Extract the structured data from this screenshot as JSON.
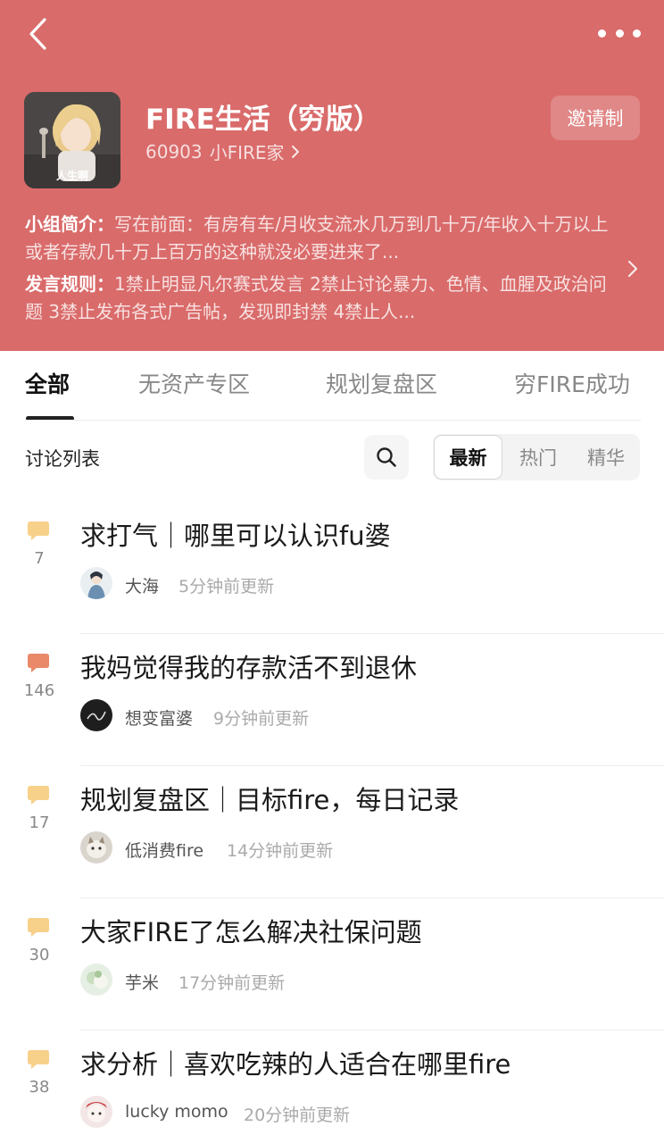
{
  "header": {
    "back_icon": "chevron-left-icon",
    "more_icon": "more-dots-icon",
    "group_title": "FIRE生活（穷版）",
    "member_count": "60903",
    "member_label": "小FIRE家",
    "invite_label": "邀请制",
    "avatar_caption": "人生啊",
    "bg_color": "#d96b6a"
  },
  "intro": {
    "summary_label": "小组简介：",
    "summary_text": "写在前面：有房有车/月收支流水几万到几十万/年收入十万以上或者存款几十万上百万的这种就没必要进来了...",
    "rules_label": "发言规则：",
    "rules_text": "1禁止明显凡尔赛式发言 2禁止讨论暴力、色情、血腥及政治问题 3禁止发布各式广告帖，发现即封禁 4禁止人..."
  },
  "tabs": [
    {
      "label": "全部",
      "active": true
    },
    {
      "label": "无资产专区",
      "active": false
    },
    {
      "label": "规划复盘区",
      "active": false
    },
    {
      "label": "穷FIRE成功",
      "active": false
    }
  ],
  "list": {
    "title": "讨论列表",
    "search_icon": "search-icon",
    "sort": [
      "最新",
      "热门",
      "精华"
    ]
  },
  "posts": [
    {
      "replies": "7",
      "title": "求打气｜哪里可以认识fu婆",
      "author": "大海",
      "time": "5分钟前更新",
      "bubble_color": "#f7d08a"
    },
    {
      "replies": "146",
      "title": "我妈觉得我的存款活不到退休",
      "author": "想变富婆",
      "time": "9分钟前更新",
      "bubble_color": "#e9896a"
    },
    {
      "replies": "17",
      "title": "规划复盘区｜目标fire，每日记录",
      "author": "低消费fire",
      "time": "14分钟前更新",
      "bubble_color": "#f7d08a"
    },
    {
      "replies": "30",
      "title": "大家FIRE了怎么解决社保问题",
      "author": "芋米",
      "time": "17分钟前更新",
      "bubble_color": "#f7d08a"
    },
    {
      "replies": "38",
      "title": "求分析｜喜欢吃辣的人适合在哪里fire",
      "author": "lucky momo",
      "time": "20分钟前更新",
      "bubble_color": "#f7d08a"
    }
  ]
}
